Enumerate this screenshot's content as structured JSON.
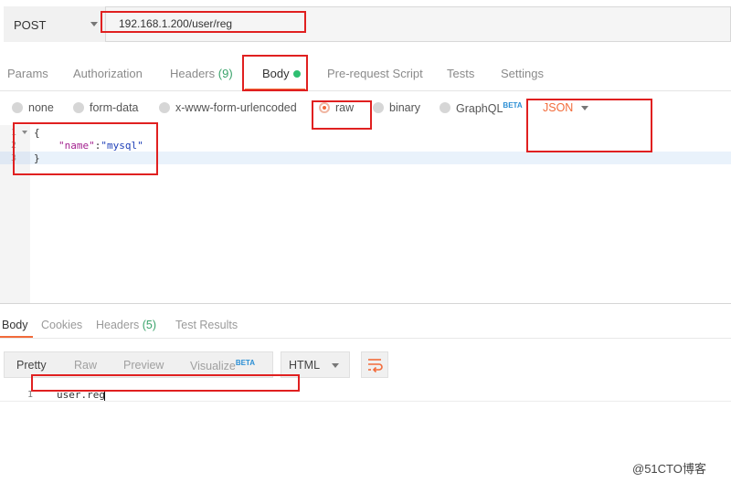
{
  "request": {
    "method": "POST",
    "url": "192.168.1.200/user/reg"
  },
  "request_tabs": [
    {
      "label": "Params"
    },
    {
      "label": "Authorization"
    },
    {
      "label": "Headers",
      "count": "(9)"
    },
    {
      "label": "Body"
    },
    {
      "label": "Pre-request Script"
    },
    {
      "label": "Tests"
    },
    {
      "label": "Settings"
    }
  ],
  "body_types": {
    "none": "none",
    "form_data": "form-data",
    "urlencoded": "x-www-form-urlencoded",
    "raw": "raw",
    "binary": "binary",
    "graphql": "GraphQL",
    "graphql_badge": "BETA",
    "selected": "raw",
    "format": "JSON"
  },
  "editor": {
    "line_numbers": [
      "1",
      "2",
      "3"
    ],
    "open_brace": "{",
    "key": "\"name\"",
    "colon": ":",
    "value": "\"mysql\"",
    "close_brace": "}"
  },
  "response_tabs": [
    {
      "label": "Body"
    },
    {
      "label": "Cookies"
    },
    {
      "label": "Headers",
      "count": "(5)"
    },
    {
      "label": "Test Results"
    }
  ],
  "response_view": {
    "modes": [
      "Pretty",
      "Raw",
      "Preview",
      "Visualize"
    ],
    "visualize_badge": "BETA",
    "language": "HTML",
    "line_number": "1",
    "content": "user.reg"
  },
  "watermark": "@51CTO博客",
  "colors": {
    "accent": "#f26b3a",
    "annotation_red": "#e02020",
    "success_green": "#2fbf71"
  },
  "icons": [
    "caret-down-icon",
    "wrap-lines-icon",
    "radio-icon",
    "fold-arrow-icon"
  ]
}
